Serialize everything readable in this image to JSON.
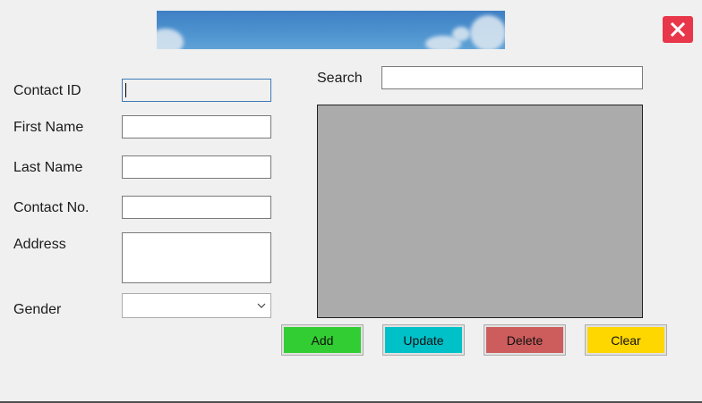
{
  "form": {
    "contact_id_label": "Contact ID",
    "contact_id_value": "",
    "first_name_label": "First Name",
    "first_name_value": "",
    "last_name_label": "Last Name",
    "last_name_value": "",
    "contact_no_label": "Contact No.",
    "contact_no_value": "",
    "address_label": "Address",
    "address_value": "",
    "gender_label": "Gender",
    "gender_value": ""
  },
  "search": {
    "label": "Search",
    "value": ""
  },
  "buttons": {
    "add": "Add",
    "update": "Update",
    "delete": "Delete",
    "clear": "Clear"
  },
  "colors": {
    "add": "#32cd32",
    "update": "#00c0c8",
    "delete": "#cd5c5c",
    "clear": "#ffd700",
    "close": "#e8374a",
    "grid": "#ababab"
  },
  "icons": {
    "close": "close-icon",
    "dropdown": "chevron-down-icon"
  }
}
